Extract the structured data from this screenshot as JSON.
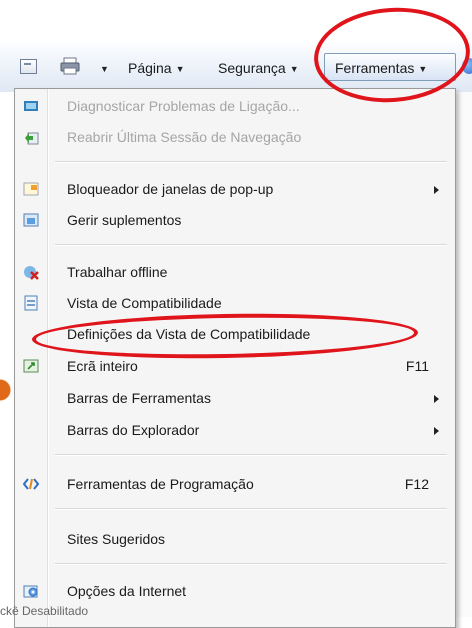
{
  "toolbar": {
    "page_label": "Página",
    "security_label": "Segurança",
    "tools_label": "Ferramentas"
  },
  "menu": {
    "items": [
      {
        "label": "Diagnosticar Problemas de Ligação...",
        "icon": "diagnose-icon",
        "disabled": true
      },
      {
        "label": "Reabrir Última Sessão de Navegação",
        "icon": "reopen-session-icon",
        "disabled": true
      },
      {
        "label": "Bloqueador de janelas de pop-up",
        "icon": "popup-blocker-icon",
        "submenu": true
      },
      {
        "label": "Gerir suplementos",
        "icon": "addons-icon"
      },
      {
        "label": "Trabalhar offline",
        "icon": "work-offline-icon"
      },
      {
        "label": "Vista de Compatibilidade",
        "icon": "compatibility-view-icon"
      },
      {
        "label": "Definições da Vista de Compatibilidade"
      },
      {
        "label": "Ecrã inteiro",
        "icon": "fullscreen-icon",
        "shortcut": "F11"
      },
      {
        "label": "Barras de Ferramentas",
        "submenu": true
      },
      {
        "label": "Barras do Explorador",
        "submenu": true
      },
      {
        "label": "Ferramentas de Programação",
        "icon": "developer-tools-icon",
        "shortcut": "F12"
      },
      {
        "label": "Sites Sugeridos"
      },
      {
        "label": "Opções da Internet",
        "icon": "internet-options-icon"
      }
    ]
  },
  "annotation_color": "#e0141b",
  "bottom_text": "ckê Desabilitado"
}
